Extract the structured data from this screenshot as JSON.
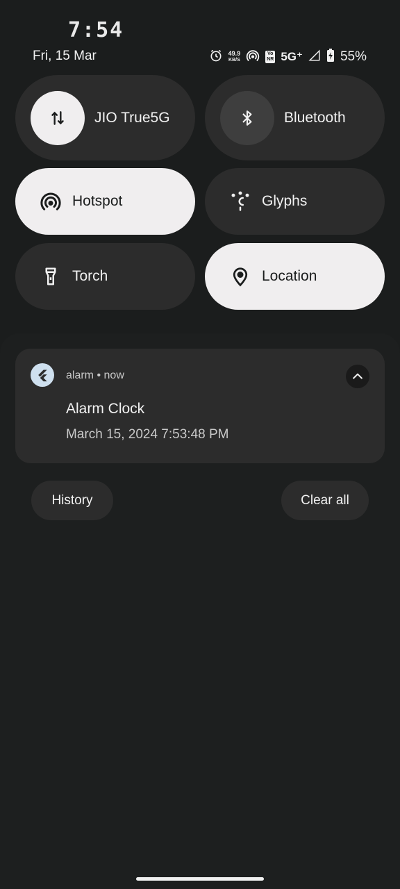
{
  "status_bar": {
    "clock": "7:54",
    "date": "Fri, 15 Mar",
    "net_speed_value": "49.9",
    "net_speed_unit": "KB/S",
    "volte_top": "Vo",
    "volte_bottom": "NR",
    "network": "5G⁺",
    "battery": "55%",
    "icons": [
      "alarm-icon",
      "hotspot-icon",
      "volte-icon",
      "signal-icon",
      "battery-charging-icon"
    ]
  },
  "quick_settings": {
    "tiles": [
      {
        "label": "JIO True5G",
        "icon": "mobile-data-icon",
        "state": "on"
      },
      {
        "label": "Bluetooth",
        "icon": "bluetooth-icon",
        "state": "off"
      },
      {
        "label": "Hotspot",
        "icon": "hotspot-icon",
        "state": "on"
      },
      {
        "label": "Glyphs",
        "icon": "glyph-icon",
        "state": "off"
      },
      {
        "label": "Torch",
        "icon": "torch-icon",
        "state": "off"
      },
      {
        "label": "Location",
        "icon": "location-icon",
        "state": "on"
      }
    ]
  },
  "notification": {
    "app": "alarm",
    "time": "now",
    "separator": "•",
    "title": "Alarm Clock",
    "text": "March 15, 2024 7:53:48 PM"
  },
  "actions": {
    "history": "History",
    "clear_all": "Clear all"
  },
  "colors": {
    "background": "#1b1d1d",
    "tile_off": "#2c2c2c",
    "tile_on": "#f0eeef",
    "text": "#f1f1f1"
  }
}
